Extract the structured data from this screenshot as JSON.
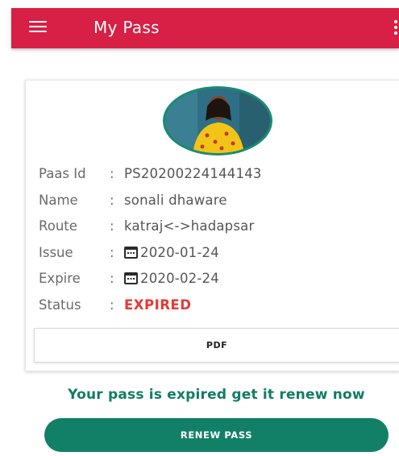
{
  "app_bar": {
    "title": "My Pass",
    "menu_icon": "hamburger-menu-icon",
    "overflow_icon": "more-vert-icon",
    "color": "#d81f45"
  },
  "pass": {
    "avatar_icon": "user-photo",
    "rows": [
      {
        "label": "Paas Id",
        "colon": ":",
        "value": "PS20200224144143"
      },
      {
        "label": "Name",
        "colon": ":",
        "value": "sonali dhaware"
      },
      {
        "label": "Route",
        "colon": ":",
        "value": "katraj<->hadapsar"
      },
      {
        "label": "Issue",
        "colon": ":",
        "value": "2020-01-24",
        "icon": "calendar-icon"
      },
      {
        "label": "Expire",
        "colon": ":",
        "value": "2020-02-24",
        "icon": "calendar-icon"
      },
      {
        "label": "Status",
        "colon": ":",
        "value": "EXPIRED",
        "color": "#e53935"
      }
    ],
    "pdf_button": "PDF"
  },
  "message": "Your pass is expired get it renew now",
  "renew_button": "RENEW PASS",
  "colors": {
    "accent_green": "#128066",
    "status_red": "#e53935"
  }
}
